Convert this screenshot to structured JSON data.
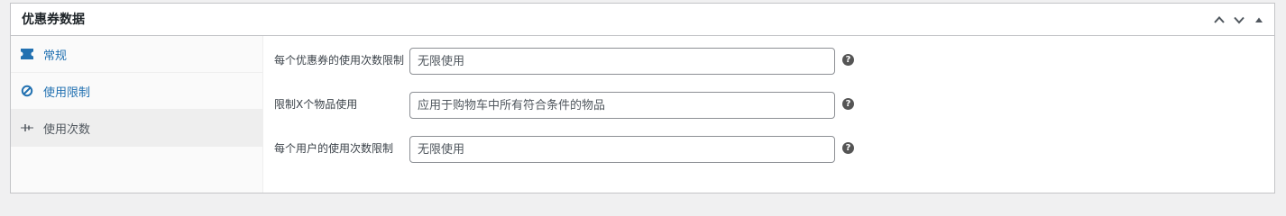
{
  "metabox": {
    "title": "优惠券数据"
  },
  "tabs": [
    {
      "label": "常规",
      "icon": "ticket-icon",
      "active": false
    },
    {
      "label": "使用限制",
      "icon": "block-icon",
      "active": false
    },
    {
      "label": "使用次数",
      "icon": "adjust-icon",
      "active": true
    }
  ],
  "fields": [
    {
      "label": "每个优惠券的使用次数限制",
      "placeholder": "无限使用",
      "help": "?"
    },
    {
      "label": "限制X个物品使用",
      "placeholder": "应用于购物车中所有符合条件的物品",
      "help": "?"
    },
    {
      "label": "每个用户的使用次数限制",
      "placeholder": "无限使用",
      "help": "?"
    }
  ],
  "colors": {
    "link": "#2271b1",
    "active_tab_bg": "#eeeeee",
    "border": "#c3c4c7"
  }
}
